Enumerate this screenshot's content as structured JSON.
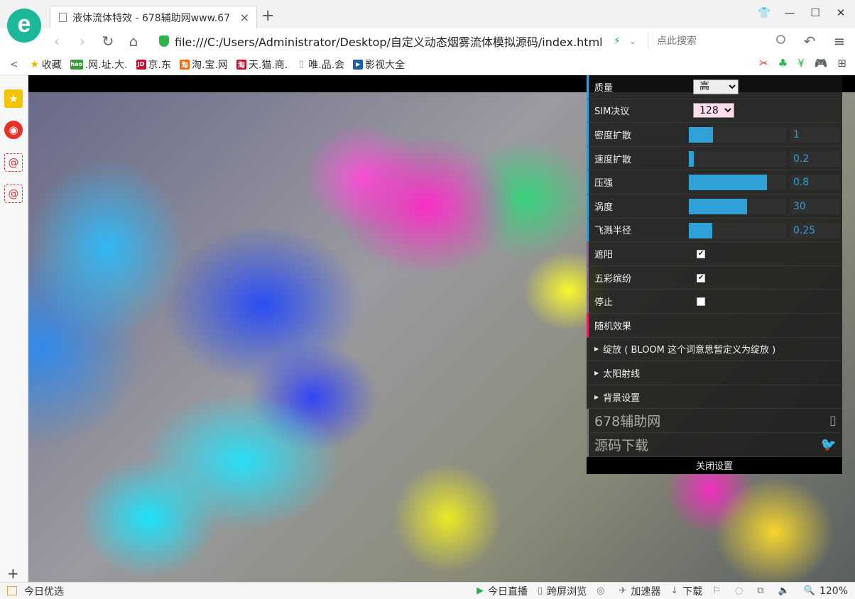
{
  "browser": {
    "logo_letter": "e",
    "tab": {
      "title": "液体流体特效 - 678辅助网www.67",
      "close": "×"
    },
    "new_tab": "+",
    "window": {
      "skin": "👕",
      "minimize": "—",
      "maximize": "☐",
      "close": "✕"
    },
    "nav": {
      "back": "‹",
      "forward": "›",
      "reload": "↻",
      "home": "⌂",
      "undo": "↶",
      "menu": "≡"
    },
    "address": {
      "url": "file:///C:/Users/Administrator/Desktop/自定义动态烟雾流体模拟源码/index.html",
      "bolt": "⚡",
      "caret": "⌄"
    },
    "search": {
      "placeholder": "点此搜索"
    },
    "bookmarks": [
      {
        "label": "收藏",
        "icon": "★",
        "icon_color": "#f0b400"
      },
      {
        "label": ".网.址.大.",
        "icon": "hao",
        "icon_color": "#3a9a3a"
      },
      {
        "label": "京.东",
        "icon": "JD",
        "icon_color": "#c8102e"
      },
      {
        "label": "淘.宝.网",
        "icon": "淘",
        "icon_color": "#ff6600"
      },
      {
        "label": "天.猫.商.",
        "icon": "淘",
        "icon_color": "#c8102e"
      },
      {
        "label": "唯.品.会",
        "icon": "▯",
        "icon_color": "#bbbbbb"
      },
      {
        "label": "影视大全",
        "icon": "▶",
        "icon_color": "#1a5fa8"
      }
    ],
    "bookmark_collapse": "<",
    "bookmark_tools": [
      "✂",
      "♣",
      "¥",
      "🎮",
      "⊞"
    ]
  },
  "sidebar": {
    "items": [
      {
        "icon": "★",
        "name": "favorites-icon",
        "bg": "#f5c400"
      },
      {
        "icon": "◉",
        "name": "weibo-icon",
        "bg": "#e6312a"
      },
      {
        "icon": "@",
        "name": "mail-icon-1",
        "bg": "#ffffff"
      },
      {
        "icon": "@",
        "name": "mail-icon-2",
        "bg": "#ffffff"
      }
    ],
    "add": "+"
  },
  "panel": {
    "quality": {
      "label": "质量",
      "value": "高",
      "options": [
        "高"
      ]
    },
    "sim_resolution": {
      "label": "SIM决议",
      "value": "128",
      "options": [
        "128"
      ]
    },
    "sliders": [
      {
        "label": "密度扩散",
        "value": "1",
        "fill": 0.25
      },
      {
        "label": "速度扩散",
        "value": "0.2",
        "fill": 0.05
      },
      {
        "label": "压强",
        "value": "0.8",
        "fill": 0.8
      },
      {
        "label": "涡度",
        "value": "30",
        "fill": 0.6
      },
      {
        "label": "飞溅半径",
        "value": "0.25",
        "fill": 0.24
      }
    ],
    "checkboxes": [
      {
        "label": "遮阳",
        "checked": true
      },
      {
        "label": "五彩缤纷",
        "checked": true
      },
      {
        "label": "停止",
        "checked": false
      }
    ],
    "random": {
      "label": "随机效果"
    },
    "folders": [
      {
        "label": "绽放 ( BLOOM 这个词意思暂定义为绽放 )"
      },
      {
        "label": "太阳射线"
      },
      {
        "label": "背景设置"
      }
    ],
    "links": [
      {
        "label": "678辅助网",
        "icon": "▯"
      },
      {
        "label": "源码下载",
        "icon": "🐦"
      }
    ],
    "close": "关闭设置"
  },
  "statusbar": {
    "left": "今日优选",
    "items": [
      {
        "icon": "▶",
        "label": "今日直播"
      },
      {
        "icon": "▯",
        "label": "跨屏浏览"
      },
      {
        "icon": "◎",
        "label": ""
      },
      {
        "icon": "✈",
        "label": "加速器"
      },
      {
        "icon": "↓",
        "label": "下载"
      },
      {
        "icon": "⚐",
        "label": ""
      },
      {
        "icon": "◌",
        "label": ""
      },
      {
        "icon": "⧉",
        "label": ""
      },
      {
        "icon": "🔈",
        "label": ""
      },
      {
        "icon": "🔍",
        "label": "120%"
      }
    ]
  }
}
